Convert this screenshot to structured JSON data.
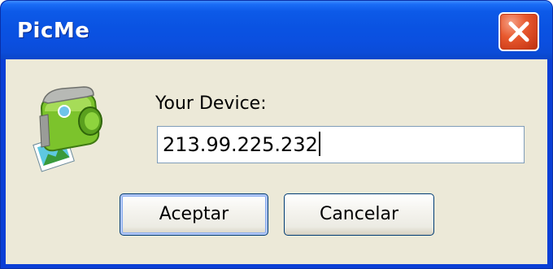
{
  "window": {
    "title": "PicMe"
  },
  "dialog": {
    "field_label": "Your Device:",
    "field_value": "213.99.225.232",
    "ok_label": "Aceptar",
    "cancel_label": "Cancelar"
  },
  "icons": {
    "app": "camera-printer-icon",
    "close": "close-icon"
  },
  "colors": {
    "titlebar": "#0a53e2",
    "client_bg": "#ece9d8",
    "close_button": "#d0401c",
    "input_border": "#7f9db9",
    "button_border": "#003c74"
  }
}
